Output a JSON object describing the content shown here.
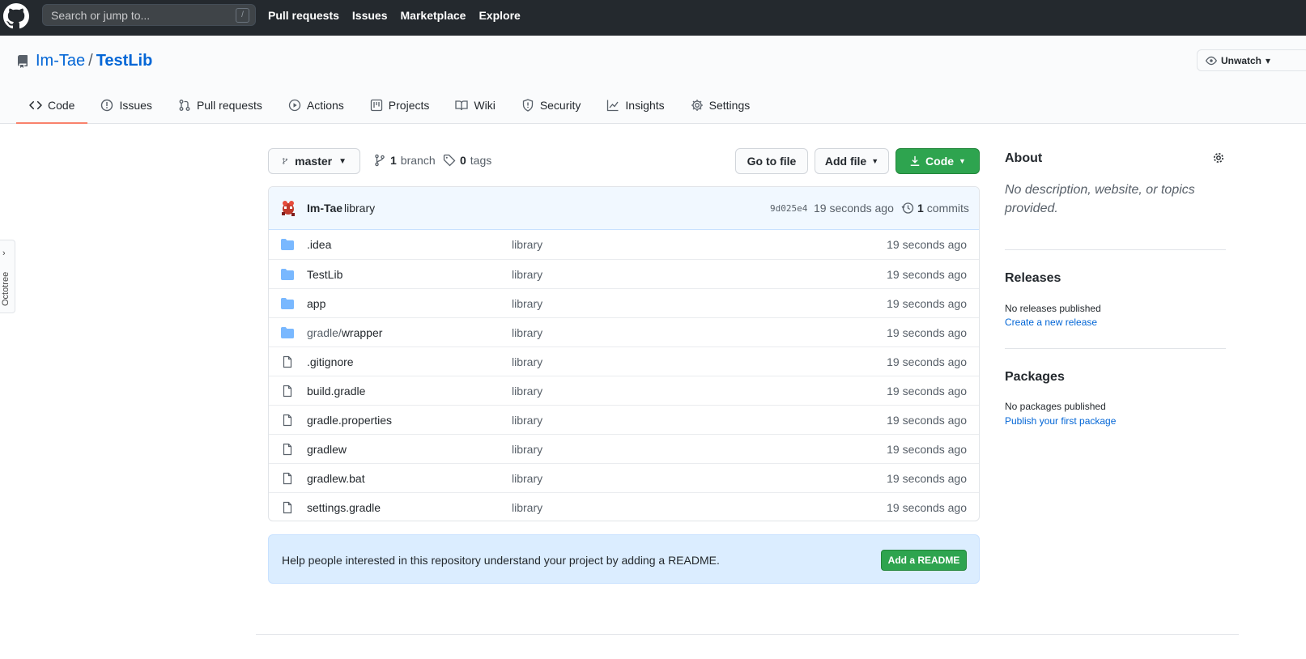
{
  "header": {
    "search_placeholder": "Search or jump to...",
    "search_shortcut": "/",
    "nav": [
      "Pull requests",
      "Issues",
      "Marketplace",
      "Explore"
    ]
  },
  "repo": {
    "owner": "Im-Tae",
    "separator": "/",
    "name": "TestLib",
    "watch_label": "Unwatch"
  },
  "tabs": [
    "Code",
    "Issues",
    "Pull requests",
    "Actions",
    "Projects",
    "Wiki",
    "Security",
    "Insights",
    "Settings"
  ],
  "octotree_label": "Octotree",
  "branchbar": {
    "branch": "master",
    "branch_count": "1",
    "branch_label": "branch",
    "tag_count": "0",
    "tag_label": "tags",
    "goto_file": "Go to file",
    "add_file": "Add file",
    "code": "Code"
  },
  "commit": {
    "author": "Im-Tae",
    "message": "library",
    "sha": "9d025e4",
    "time": "19 seconds ago",
    "count": "1",
    "count_label": "commits"
  },
  "files": [
    {
      "type": "dir",
      "name": ".idea",
      "prefix": "",
      "msg": "library",
      "age": "19 seconds ago"
    },
    {
      "type": "dir",
      "name": "TestLib",
      "prefix": "",
      "msg": "library",
      "age": "19 seconds ago"
    },
    {
      "type": "dir",
      "name": "app",
      "prefix": "",
      "msg": "library",
      "age": "19 seconds ago"
    },
    {
      "type": "dir",
      "name": "wrapper",
      "prefix": "gradle/",
      "msg": "library",
      "age": "19 seconds ago"
    },
    {
      "type": "file",
      "name": ".gitignore",
      "prefix": "",
      "msg": "library",
      "age": "19 seconds ago"
    },
    {
      "type": "file",
      "name": "build.gradle",
      "prefix": "",
      "msg": "library",
      "age": "19 seconds ago"
    },
    {
      "type": "file",
      "name": "gradle.properties",
      "prefix": "",
      "msg": "library",
      "age": "19 seconds ago"
    },
    {
      "type": "file",
      "name": "gradlew",
      "prefix": "",
      "msg": "library",
      "age": "19 seconds ago"
    },
    {
      "type": "file",
      "name": "gradlew.bat",
      "prefix": "",
      "msg": "library",
      "age": "19 seconds ago"
    },
    {
      "type": "file",
      "name": "settings.gradle",
      "prefix": "",
      "msg": "library",
      "age": "19 seconds ago"
    }
  ],
  "readme": {
    "text": "Help people interested in this repository understand your project by adding a README.",
    "button": "Add a README"
  },
  "sidebar": {
    "about_title": "About",
    "about_desc": "No description, website, or topics provided.",
    "releases_title": "Releases",
    "releases_text": "No releases published",
    "releases_link": "Create a new release",
    "packages_title": "Packages",
    "packages_text": "No packages published",
    "packages_link": "Publish your first package"
  },
  "colors": {
    "header_bg": "#24292e",
    "link": "#0366d6",
    "green": "#2ea44f",
    "folder": "#79b8ff",
    "active_tab": "#f9826c"
  }
}
